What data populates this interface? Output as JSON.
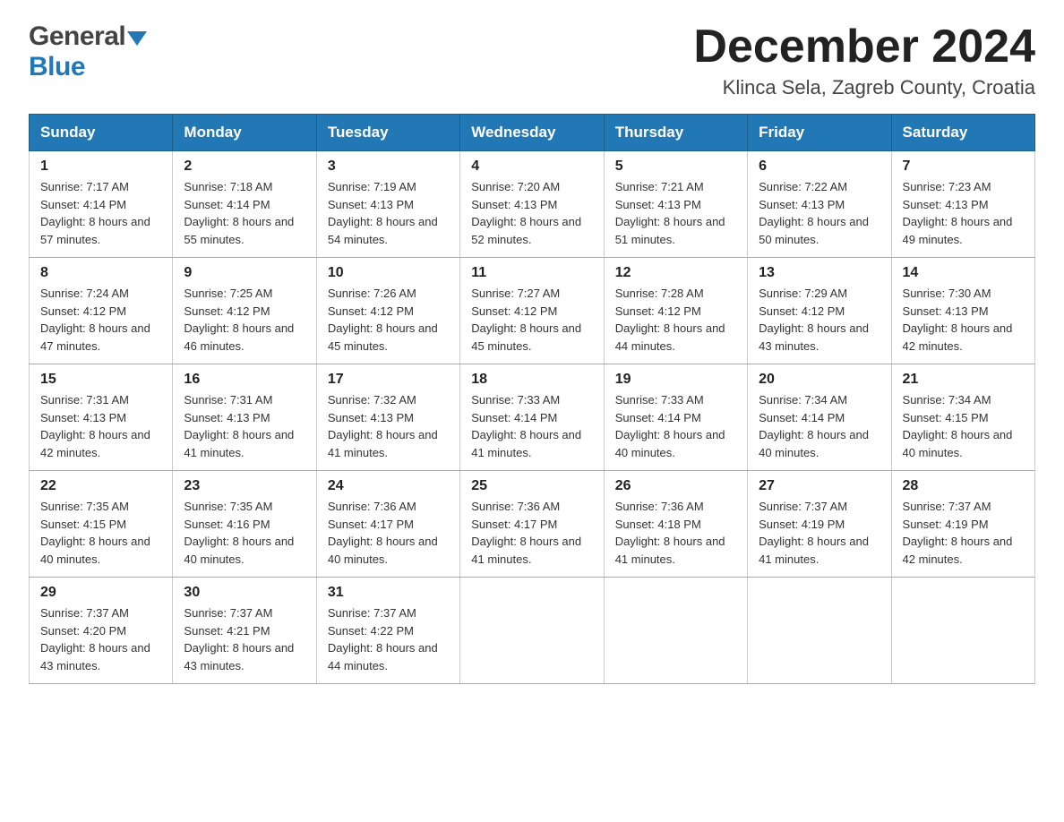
{
  "header": {
    "logo_general": "General",
    "logo_blue": "Blue",
    "month_year": "December 2024",
    "location": "Klinca Sela, Zagreb County, Croatia"
  },
  "weekdays": [
    "Sunday",
    "Monday",
    "Tuesday",
    "Wednesday",
    "Thursday",
    "Friday",
    "Saturday"
  ],
  "weeks": [
    [
      {
        "day": "1",
        "sunrise": "7:17 AM",
        "sunset": "4:14 PM",
        "daylight": "8 hours and 57 minutes."
      },
      {
        "day": "2",
        "sunrise": "7:18 AM",
        "sunset": "4:14 PM",
        "daylight": "8 hours and 55 minutes."
      },
      {
        "day": "3",
        "sunrise": "7:19 AM",
        "sunset": "4:13 PM",
        "daylight": "8 hours and 54 minutes."
      },
      {
        "day": "4",
        "sunrise": "7:20 AM",
        "sunset": "4:13 PM",
        "daylight": "8 hours and 52 minutes."
      },
      {
        "day": "5",
        "sunrise": "7:21 AM",
        "sunset": "4:13 PM",
        "daylight": "8 hours and 51 minutes."
      },
      {
        "day": "6",
        "sunrise": "7:22 AM",
        "sunset": "4:13 PM",
        "daylight": "8 hours and 50 minutes."
      },
      {
        "day": "7",
        "sunrise": "7:23 AM",
        "sunset": "4:13 PM",
        "daylight": "8 hours and 49 minutes."
      }
    ],
    [
      {
        "day": "8",
        "sunrise": "7:24 AM",
        "sunset": "4:12 PM",
        "daylight": "8 hours and 47 minutes."
      },
      {
        "day": "9",
        "sunrise": "7:25 AM",
        "sunset": "4:12 PM",
        "daylight": "8 hours and 46 minutes."
      },
      {
        "day": "10",
        "sunrise": "7:26 AM",
        "sunset": "4:12 PM",
        "daylight": "8 hours and 45 minutes."
      },
      {
        "day": "11",
        "sunrise": "7:27 AM",
        "sunset": "4:12 PM",
        "daylight": "8 hours and 45 minutes."
      },
      {
        "day": "12",
        "sunrise": "7:28 AM",
        "sunset": "4:12 PM",
        "daylight": "8 hours and 44 minutes."
      },
      {
        "day": "13",
        "sunrise": "7:29 AM",
        "sunset": "4:12 PM",
        "daylight": "8 hours and 43 minutes."
      },
      {
        "day": "14",
        "sunrise": "7:30 AM",
        "sunset": "4:13 PM",
        "daylight": "8 hours and 42 minutes."
      }
    ],
    [
      {
        "day": "15",
        "sunrise": "7:31 AM",
        "sunset": "4:13 PM",
        "daylight": "8 hours and 42 minutes."
      },
      {
        "day": "16",
        "sunrise": "7:31 AM",
        "sunset": "4:13 PM",
        "daylight": "8 hours and 41 minutes."
      },
      {
        "day": "17",
        "sunrise": "7:32 AM",
        "sunset": "4:13 PM",
        "daylight": "8 hours and 41 minutes."
      },
      {
        "day": "18",
        "sunrise": "7:33 AM",
        "sunset": "4:14 PM",
        "daylight": "8 hours and 41 minutes."
      },
      {
        "day": "19",
        "sunrise": "7:33 AM",
        "sunset": "4:14 PM",
        "daylight": "8 hours and 40 minutes."
      },
      {
        "day": "20",
        "sunrise": "7:34 AM",
        "sunset": "4:14 PM",
        "daylight": "8 hours and 40 minutes."
      },
      {
        "day": "21",
        "sunrise": "7:34 AM",
        "sunset": "4:15 PM",
        "daylight": "8 hours and 40 minutes."
      }
    ],
    [
      {
        "day": "22",
        "sunrise": "7:35 AM",
        "sunset": "4:15 PM",
        "daylight": "8 hours and 40 minutes."
      },
      {
        "day": "23",
        "sunrise": "7:35 AM",
        "sunset": "4:16 PM",
        "daylight": "8 hours and 40 minutes."
      },
      {
        "day": "24",
        "sunrise": "7:36 AM",
        "sunset": "4:17 PM",
        "daylight": "8 hours and 40 minutes."
      },
      {
        "day": "25",
        "sunrise": "7:36 AM",
        "sunset": "4:17 PM",
        "daylight": "8 hours and 41 minutes."
      },
      {
        "day": "26",
        "sunrise": "7:36 AM",
        "sunset": "4:18 PM",
        "daylight": "8 hours and 41 minutes."
      },
      {
        "day": "27",
        "sunrise": "7:37 AM",
        "sunset": "4:19 PM",
        "daylight": "8 hours and 41 minutes."
      },
      {
        "day": "28",
        "sunrise": "7:37 AM",
        "sunset": "4:19 PM",
        "daylight": "8 hours and 42 minutes."
      }
    ],
    [
      {
        "day": "29",
        "sunrise": "7:37 AM",
        "sunset": "4:20 PM",
        "daylight": "8 hours and 43 minutes."
      },
      {
        "day": "30",
        "sunrise": "7:37 AM",
        "sunset": "4:21 PM",
        "daylight": "8 hours and 43 minutes."
      },
      {
        "day": "31",
        "sunrise": "7:37 AM",
        "sunset": "4:22 PM",
        "daylight": "8 hours and 44 minutes."
      },
      null,
      null,
      null,
      null
    ]
  ],
  "labels": {
    "sunrise": "Sunrise:",
    "sunset": "Sunset:",
    "daylight": "Daylight:"
  }
}
